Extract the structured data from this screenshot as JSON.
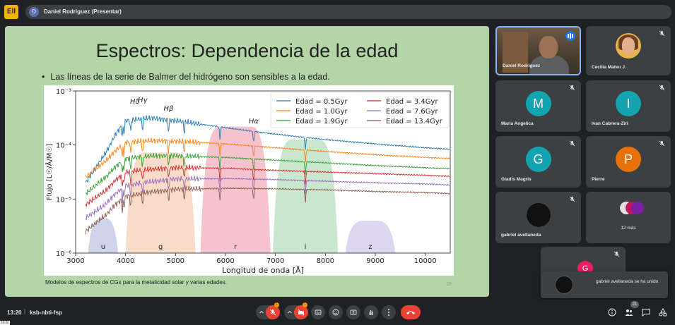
{
  "app": {
    "logo_text": "Ell"
  },
  "presenter": {
    "avatar_letter": "D",
    "label": "Daniel Rodriguez (Presentar)"
  },
  "slide": {
    "title": "Espectros: Dependencia de la edad",
    "bullet": "Las líneas de la serie de Balmer del hidrógeno son sensibles a la edad.",
    "caption": "Modelos de espectros de CGs para la metalicidad solar y varias edades.",
    "page_number": "18"
  },
  "chart_data": {
    "type": "line",
    "xlabel": "Longitud de onda [Å]",
    "ylabel": "Flujo [L☉/Å/M☉]",
    "xlim": [
      3000,
      10500
    ],
    "ylim_log10": [
      -6,
      -3
    ],
    "x_ticks": [
      "3000",
      "4000",
      "5000",
      "6000",
      "7000",
      "8000",
      "9000",
      "10000"
    ],
    "y_ticks": [
      "10⁻⁶",
      "10⁻⁵",
      "10⁻⁴",
      "10⁻³"
    ],
    "legend_placement": "top-right",
    "series": [
      {
        "name": "Edad = 0.5Gyr",
        "color": "#1f77b4",
        "x": [
          3200,
          3600,
          3800,
          4000,
          4500,
          5000,
          6000,
          7000,
          8000,
          9000,
          10000,
          10500
        ],
        "log10_y": [
          -4.7,
          -4.15,
          -3.8,
          -3.55,
          -3.5,
          -3.55,
          -3.68,
          -3.8,
          -3.9,
          -3.98,
          -4.05,
          -4.08
        ]
      },
      {
        "name": "Edad = 1.0Gyr",
        "color": "#ff7f0e",
        "x": [
          3200,
          3600,
          3800,
          4000,
          4500,
          5000,
          6000,
          7000,
          8000,
          9000,
          10000,
          10500
        ],
        "log10_y": [
          -4.6,
          -4.3,
          -4.1,
          -3.95,
          -3.92,
          -3.93,
          -3.98,
          -4.05,
          -4.12,
          -4.18,
          -4.23,
          -4.25
        ]
      },
      {
        "name": "Edad = 1.9Gyr",
        "color": "#2ca02c",
        "x": [
          3200,
          3600,
          3800,
          4000,
          4500,
          5000,
          6000,
          7000,
          8000,
          9000,
          10000,
          10500
        ],
        "log10_y": [
          -4.9,
          -4.6,
          -4.4,
          -4.25,
          -4.2,
          -4.2,
          -4.23,
          -4.28,
          -4.33,
          -4.38,
          -4.42,
          -4.44
        ]
      },
      {
        "name": "Edad = 3.4Gyr",
        "color": "#d62728",
        "x": [
          3200,
          3600,
          3800,
          4000,
          4500,
          5000,
          6000,
          7000,
          8000,
          9000,
          10000,
          10500
        ],
        "log10_y": [
          -5.1,
          -4.85,
          -4.65,
          -4.5,
          -4.45,
          -4.42,
          -4.43,
          -4.47,
          -4.5,
          -4.53,
          -4.56,
          -4.58
        ]
      },
      {
        "name": "Edad = 7.6Gyr",
        "color": "#9467bd",
        "x": [
          3200,
          3600,
          3800,
          4000,
          4500,
          5000,
          6000,
          7000,
          8000,
          9000,
          10000,
          10500
        ],
        "log10_y": [
          -5.35,
          -5.1,
          -4.9,
          -4.75,
          -4.68,
          -4.63,
          -4.62,
          -4.64,
          -4.67,
          -4.7,
          -4.72,
          -4.74
        ]
      },
      {
        "name": "Edad = 13.4Gyr",
        "color": "#8c564b",
        "x": [
          3200,
          3600,
          3800,
          4000,
          4500,
          5000,
          6000,
          7000,
          8000,
          9000,
          10000,
          10500
        ],
        "log10_y": [
          -5.6,
          -5.3,
          -5.1,
          -4.95,
          -4.87,
          -4.82,
          -4.8,
          -4.81,
          -4.83,
          -4.86,
          -4.88,
          -4.9
        ]
      }
    ],
    "annotations": [
      {
        "text": "Hγ",
        "x": 4340
      },
      {
        "text": "Hδ",
        "x": 4102
      },
      {
        "text": "Hβ",
        "x": 4861
      },
      {
        "text": "Hα",
        "x": 6563
      }
    ],
    "filters": [
      {
        "name": "u",
        "center": 3550,
        "width": 600,
        "color": "#c5cbe6",
        "peak": 0.22
      },
      {
        "name": "g",
        "center": 4700,
        "width": 1400,
        "color": "#f6d7bf",
        "peak": 0.62
      },
      {
        "name": "r",
        "center": 6200,
        "width": 1400,
        "color": "#f3b9c4",
        "peak": 0.78
      },
      {
        "name": "i",
        "center": 7600,
        "width": 1300,
        "color": "#bfe2c7",
        "peak": 0.7
      },
      {
        "name": "z",
        "center": 8900,
        "width": 1000,
        "color": "#d6d0ec",
        "peak": 0.2
      }
    ]
  },
  "participants": [
    {
      "name": "Daniel Rodriguez",
      "speaking": true
    },
    {
      "name": "Cecilia Mateu J."
    },
    {
      "name": "María Angelica",
      "letter": "M",
      "color": "#12a4af"
    },
    {
      "name": "Ivan Cabrera-Ziri",
      "letter": "I",
      "color": "#12a4af"
    },
    {
      "name": "Gladis Magris",
      "letter": "G",
      "color": "#12a4af"
    },
    {
      "name": "Pierre",
      "letter": "P",
      "color": "#e8710a"
    },
    {
      "name": "gabriel avellaneda"
    }
  ],
  "more": {
    "label": "12 más"
  },
  "partial_tile": {
    "letter": "G"
  },
  "toast": {
    "text": "gabriel avellaneda se ha unido"
  },
  "bottom": {
    "time": "13:20",
    "separator": "|",
    "meeting_code": "ksb-nbti-fsp",
    "participant_count": "21",
    "start_label": "Inicio"
  },
  "colors": {
    "accent": "#8ab4f8",
    "danger": "#ea4335",
    "tile": "#3c4043",
    "background": "#202124"
  }
}
